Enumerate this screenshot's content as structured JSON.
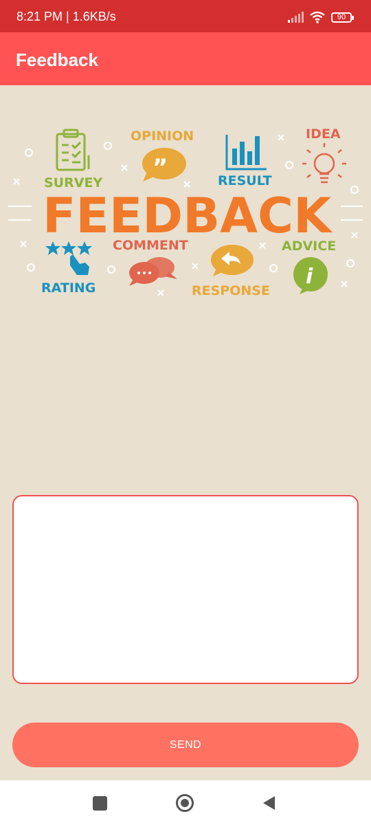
{
  "status_bar": {
    "time_speed": "8:21 PM | 1.6KB/s",
    "battery_level": "90",
    "icons": [
      "signal-icon",
      "wifi-icon",
      "battery-icon"
    ]
  },
  "app_bar": {
    "title": "Feedback"
  },
  "banner": {
    "headline": "FEEDBACK",
    "words": {
      "survey": "SURVEY",
      "opinion": "OPINION",
      "result": "RESULT",
      "idea": "IDEA",
      "comment": "COMMENT",
      "advice": "ADVICE",
      "rating": "RATING",
      "response": "RESPONSE"
    },
    "colors": {
      "orange": "#f07a2a",
      "green": "#8db33a",
      "blue": "#1a92bf",
      "yellow": "#e8a83a",
      "red": "#e0654e"
    }
  },
  "form": {
    "feedback_value": "",
    "send_label": "SEND"
  },
  "nav_bar": {
    "icons": [
      "recents-square-icon",
      "home-circle-icon",
      "back-triangle-icon"
    ]
  }
}
